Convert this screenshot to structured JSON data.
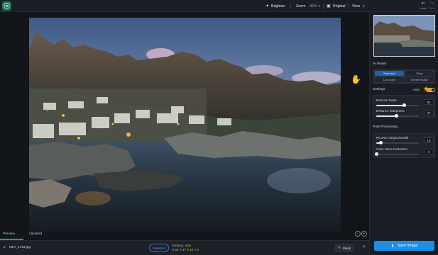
{
  "toolbar": {
    "brighten_label": "Brighten",
    "zoom_label": "Zoom",
    "zoom_value": "96%",
    "original_label": "Original",
    "view_label": "View",
    "undo_label": "Undo",
    "redo_label": "Redo"
  },
  "canvas": {
    "tabs": [
      {
        "label": "Preview",
        "active": true
      },
      {
        "label": "Updated",
        "active": false
      }
    ]
  },
  "bottombar": {
    "file_name": "IMG_1743.jpg",
    "model_pill": "Standard",
    "settings_prefix": "Settings:",
    "settings_mode": "Auto",
    "vals": [
      {
        "key": "N",
        "value": "65"
      },
      {
        "key": "S",
        "value": "47"
      },
      {
        "key": "R",
        "value": "10"
      },
      {
        "key": "C",
        "value": "0"
      }
    ],
    "mask_label": "Mask"
  },
  "panel": {
    "ai_model_title": "AI Model",
    "models": [
      {
        "label": "Standard",
        "selected": true
      },
      {
        "label": "Clear",
        "selected": false
      },
      {
        "label": "Low Light",
        "selected": false
      },
      {
        "label": "Severe Noise",
        "selected": false
      }
    ],
    "settings_title": "Settings",
    "auto_label": "Auto",
    "settings_sliders": [
      {
        "label": "Remove Noise",
        "value": 65
      },
      {
        "label": "Enhance Sharpness",
        "value": 47
      }
    ],
    "post_title": "Post-Processing",
    "post_sliders": [
      {
        "label": "Recover Original Detail",
        "value": 10
      },
      {
        "label": "Color Noise Reduction",
        "value": 0
      }
    ],
    "save_label": "Save Image"
  },
  "colors": {
    "accent_blue": "#1d8fe6",
    "selected_model": "#1f5fae",
    "auto_yellow": "#f0b83a",
    "preview_underline": "#1aa37a"
  }
}
